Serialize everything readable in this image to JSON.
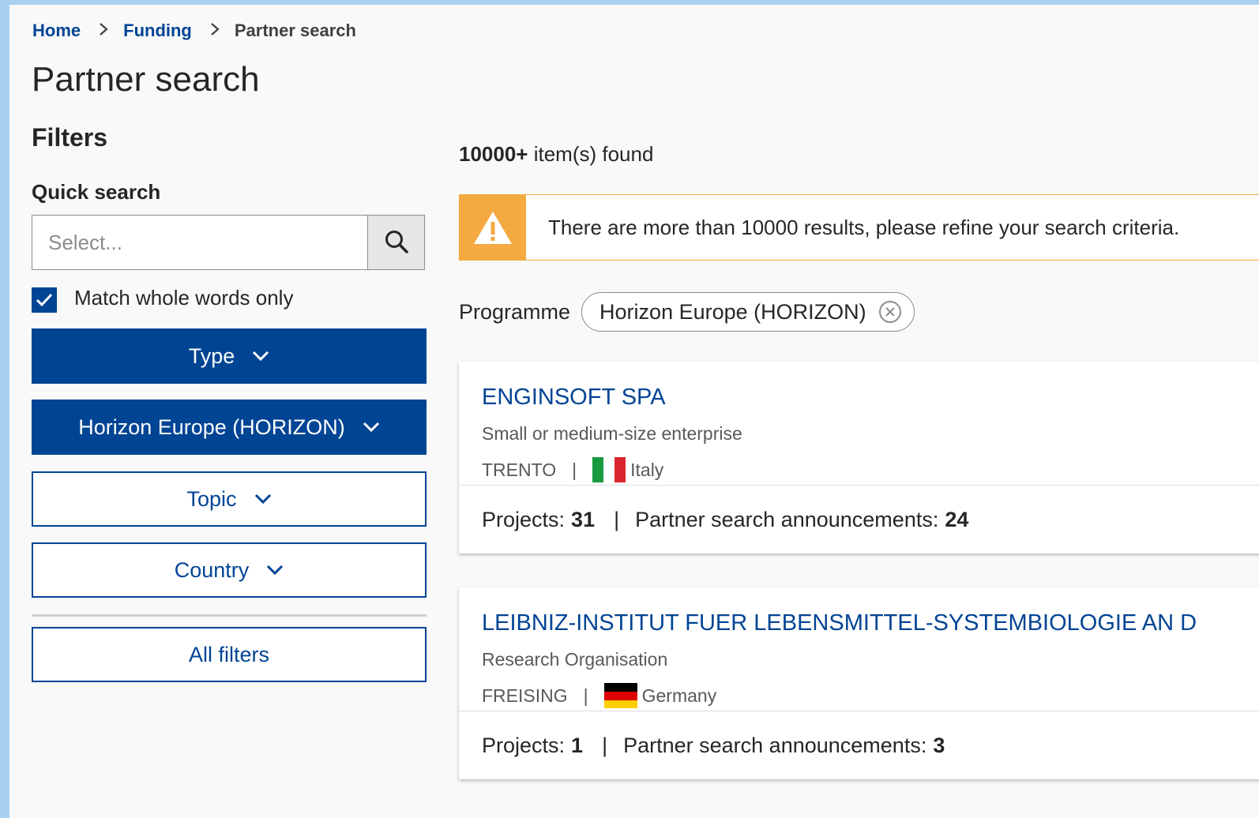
{
  "breadcrumb": {
    "home": "Home",
    "funding": "Funding",
    "current": "Partner search"
  },
  "page_title": "Partner search",
  "filters": {
    "title": "Filters",
    "quick_search_label": "Quick search",
    "search_placeholder": "Select...",
    "match_whole_words": "Match whole words only",
    "match_whole_words_checked": true,
    "type_button": "Type",
    "programme_button": "Horizon Europe (HORIZON)",
    "topic_button": "Topic",
    "country_button": "Country",
    "all_filters_button": "All filters"
  },
  "results": {
    "count": "10000+",
    "count_suffix": "item(s) found",
    "alert_text": "There are more than 10000 results, please refine your search criteria.",
    "active_filter_label": "Programme",
    "active_filter_chip": "Horizon Europe (HORIZON)"
  },
  "cards": [
    {
      "name": "ENGINSOFT SPA",
      "type": "Small or medium-size enterprise",
      "city": "TRENTO",
      "country": "Italy",
      "flag": "italy-flag",
      "projects_label": "Projects:",
      "projects": "31",
      "announcements_label": "Partner search announcements:",
      "announcements": "24"
    },
    {
      "name": "LEIBNIZ-INSTITUT FUER LEBENSMITTEL-SYSTEMBIOLOGIE AN D",
      "type": "Research Organisation",
      "city": "FREISING",
      "country": "Germany",
      "flag": "germany-flag",
      "projects_label": "Projects:",
      "projects": "1",
      "announcements_label": "Partner search announcements:",
      "announcements": "3"
    }
  ],
  "colors": {
    "primary": "#004494",
    "warning": "#f4a941",
    "text": "#262626",
    "muted": "#595959"
  }
}
